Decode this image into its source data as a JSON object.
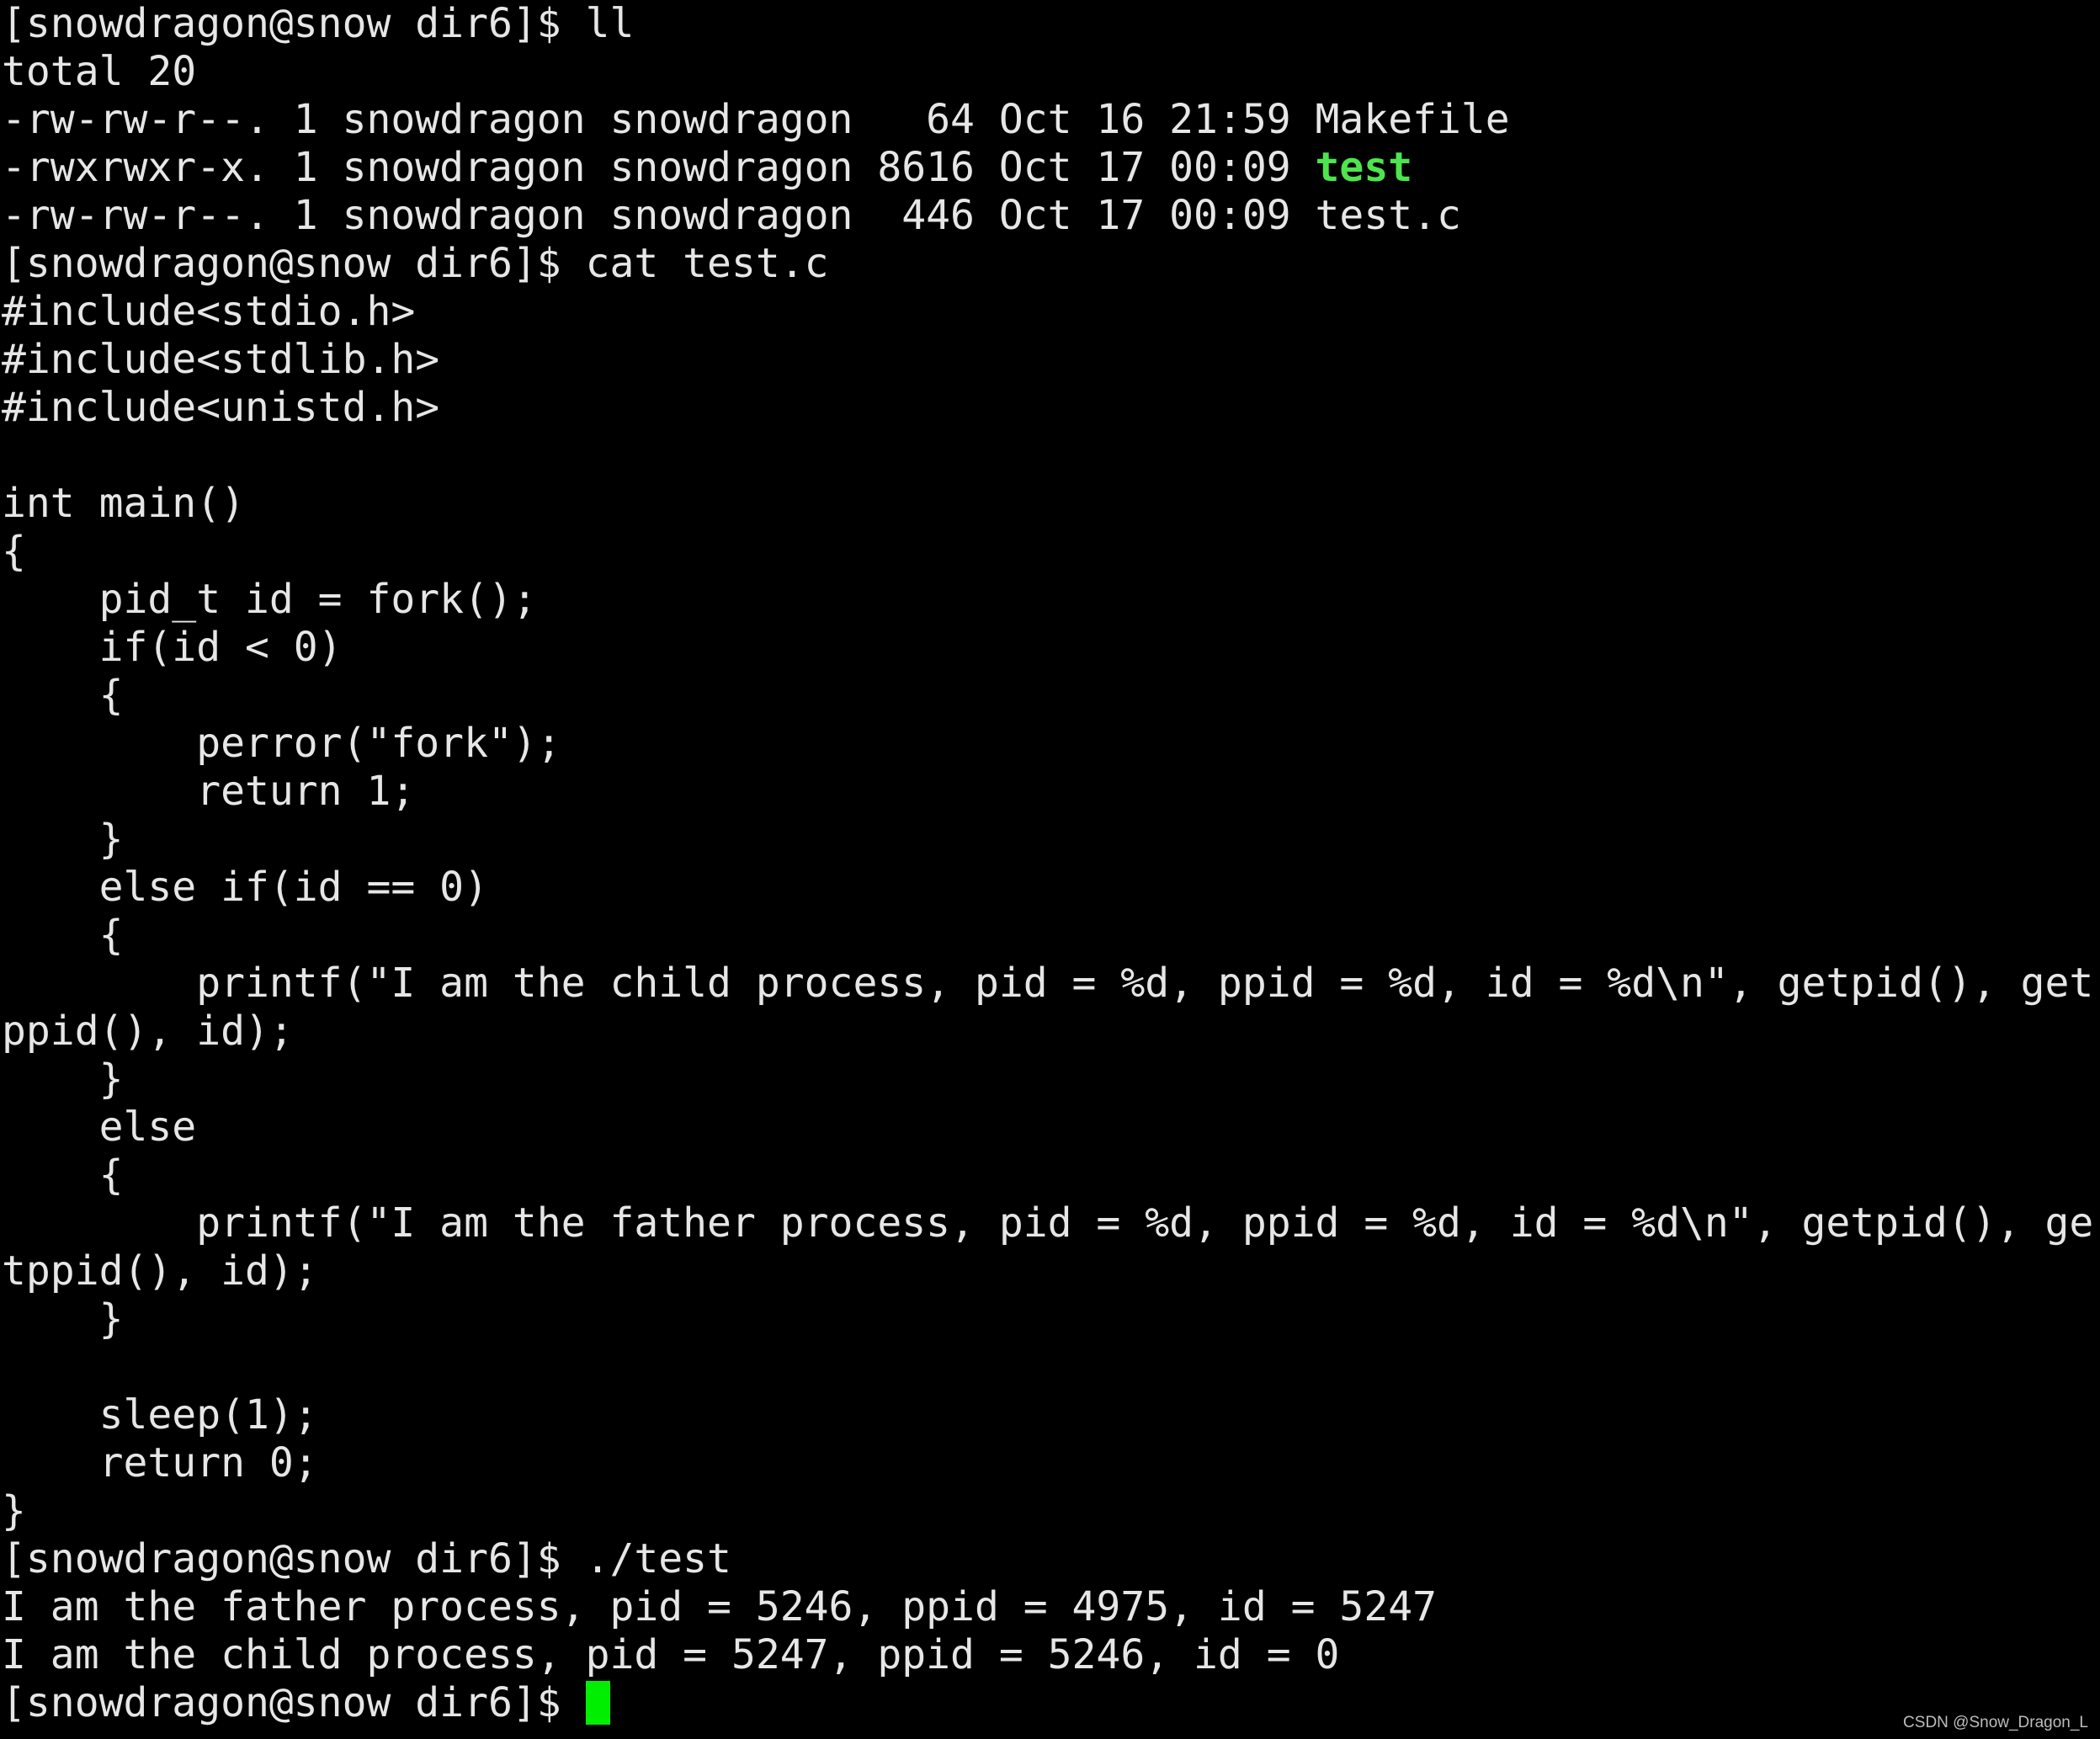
{
  "terminal": {
    "colors": {
      "background": "#000000",
      "text": "#e6e6e6",
      "executable": "#4de44d",
      "cursor": "#00ee00"
    },
    "lines": [
      [
        {
          "t": "[snowdragon@snow dir6]$ ll"
        }
      ],
      [
        {
          "t": "total 20"
        }
      ],
      [
        {
          "t": "-rw-rw-r--. 1 snowdragon snowdragon   64 Oct 16 21:59 "
        },
        {
          "t": "Makefile"
        }
      ],
      [
        {
          "t": "-rwxrwxr-x. 1 snowdragon snowdragon 8616 Oct 17 00:09 "
        },
        {
          "t": "test",
          "c": "exec"
        }
      ],
      [
        {
          "t": "-rw-rw-r--. 1 snowdragon snowdragon  446 Oct 17 00:09 "
        },
        {
          "t": "test.c"
        }
      ],
      [
        {
          "t": "[snowdragon@snow dir6]$ cat test.c"
        }
      ],
      [
        {
          "t": "#include<stdio.h>"
        }
      ],
      [
        {
          "t": "#include<stdlib.h>"
        }
      ],
      [
        {
          "t": "#include<unistd.h>"
        }
      ],
      [
        {
          "t": ""
        }
      ],
      [
        {
          "t": "int main()"
        }
      ],
      [
        {
          "t": "{"
        }
      ],
      [
        {
          "t": "    pid_t id = fork();"
        }
      ],
      [
        {
          "t": "    if(id < 0)"
        }
      ],
      [
        {
          "t": "    {"
        }
      ],
      [
        {
          "t": "        perror(\"fork\");"
        }
      ],
      [
        {
          "t": "        return 1;"
        }
      ],
      [
        {
          "t": "    }"
        }
      ],
      [
        {
          "t": "    else if(id == 0)"
        }
      ],
      [
        {
          "t": "    {"
        }
      ],
      [
        {
          "t": "        printf(\"I am the child process, pid = %d, ppid = %d, id = %d\\n\", getpid(), get"
        }
      ],
      [
        {
          "t": "ppid(), id);"
        }
      ],
      [
        {
          "t": "    }"
        }
      ],
      [
        {
          "t": "    else"
        }
      ],
      [
        {
          "t": "    {"
        }
      ],
      [
        {
          "t": "        printf(\"I am the father process, pid = %d, ppid = %d, id = %d\\n\", getpid(), ge"
        }
      ],
      [
        {
          "t": "tppid(), id);"
        }
      ],
      [
        {
          "t": "    }"
        }
      ],
      [
        {
          "t": ""
        }
      ],
      [
        {
          "t": "    sleep(1);"
        }
      ],
      [
        {
          "t": "    return 0;"
        }
      ],
      [
        {
          "t": "}"
        }
      ],
      [
        {
          "t": "[snowdragon@snow dir6]$ ./test"
        }
      ],
      [
        {
          "t": "I am the father process, pid = 5246, ppid = 4975, id = 5247"
        }
      ],
      [
        {
          "t": "I am the child process, pid = 5247, ppid = 5246, id = 0"
        }
      ],
      [
        {
          "t": "[snowdragon@snow dir6]$ "
        },
        {
          "t": "",
          "c": "cursor"
        }
      ]
    ]
  },
  "watermark": "CSDN @Snow_Dragon_L"
}
